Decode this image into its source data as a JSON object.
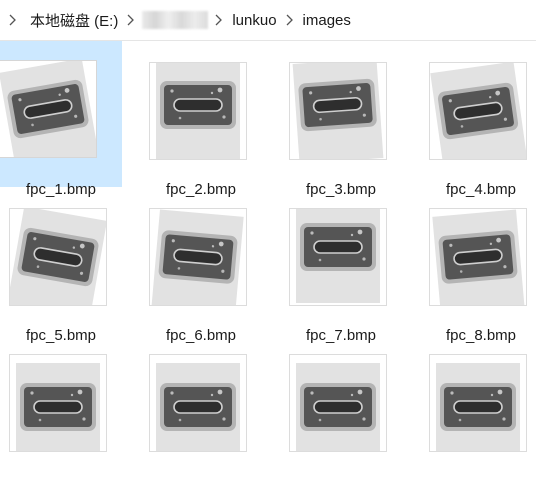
{
  "breadcrumb": {
    "drive": "本地磁盘 (E:)",
    "folder_blurred": "",
    "folder1": "lunkuo",
    "folder2": "images"
  },
  "files": [
    {
      "label": "fpc_1.bmp",
      "selected": true
    },
    {
      "label": "fpc_2.bmp",
      "selected": false
    },
    {
      "label": "fpc_3.bmp",
      "selected": false
    },
    {
      "label": "fpc_4.bmp",
      "selected": false
    },
    {
      "label": "fpc_5.bmp",
      "selected": false
    },
    {
      "label": "fpc_6.bmp",
      "selected": false
    },
    {
      "label": "fpc_7.bmp",
      "selected": false
    },
    {
      "label": "fpc_8.bmp",
      "selected": false
    },
    {
      "label": "",
      "selected": false
    },
    {
      "label": "",
      "selected": false
    },
    {
      "label": "",
      "selected": false
    },
    {
      "label": "",
      "selected": false
    }
  ],
  "colors": {
    "selection": "#cce8ff",
    "sample_dark": "#4a4a4a",
    "sample_border": "#a8a8a8",
    "sample_bg": "#d8d8d8"
  }
}
